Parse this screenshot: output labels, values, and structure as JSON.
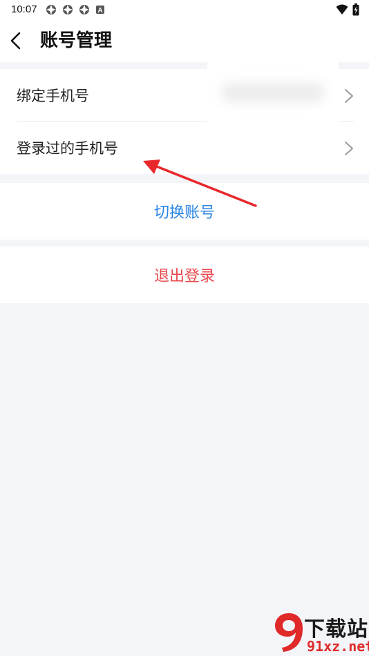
{
  "status_bar": {
    "time": "10:07",
    "left_icons": [
      "app-notification-icon",
      "app-notification-icon",
      "app-notification-icon",
      "a-badge-icon"
    ],
    "right_icons": [
      "wifi-icon",
      "battery-charging-icon"
    ]
  },
  "header": {
    "back_icon": "chevron-left-icon",
    "title": "账号管理"
  },
  "settings_list": {
    "items": [
      {
        "label": "绑定手机号",
        "icon": "chevron-right-icon"
      },
      {
        "label": "登录过的手机号",
        "icon": "chevron-right-icon"
      }
    ]
  },
  "actions": {
    "switch_account": "切换账号",
    "logout": "退出登录"
  },
  "annotation": {
    "arrow_color": "#e8282b"
  },
  "watermark": {
    "title": "下载站",
    "domain": "91xz.net"
  },
  "colors": {
    "accent_blue": "#2a86e6",
    "danger_red": "#e8484d",
    "background": "#f4f5f9"
  }
}
